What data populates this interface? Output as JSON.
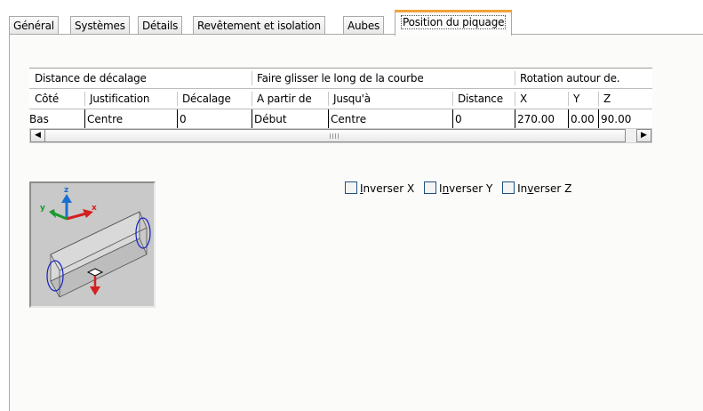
{
  "tabs": [
    {
      "label": "Général",
      "active": false
    },
    {
      "label": "Systèmes",
      "active": false
    },
    {
      "label": "Détails",
      "active": false
    },
    {
      "label": "Revêtement et isolation",
      "active": false
    },
    {
      "label": "Aubes",
      "active": false
    },
    {
      "label": "Position du piquage",
      "active": true
    }
  ],
  "table": {
    "groups": [
      "Distance de décalage",
      "Faire glisser le long de la courbe",
      "Rotation autour de."
    ],
    "columns": [
      "Côté",
      "Justification",
      "Décalage",
      "A partir de",
      "Jusqu'à",
      "Distance",
      "X",
      "Y",
      "Z"
    ],
    "row": [
      "Bas",
      "Centre",
      "0",
      "Début",
      "Centre",
      "0",
      "270.00",
      "0.00",
      "90.00"
    ]
  },
  "scrollbar": {
    "left_arrow": "◀",
    "right_arrow": "▶"
  },
  "preview": {
    "axis_x": "x",
    "axis_y": "y",
    "axis_z": "z"
  },
  "checkboxes": [
    {
      "pre": "",
      "mnemonic": "I",
      "post": "nverser X",
      "checked": false
    },
    {
      "pre": "I",
      "mnemonic": "n",
      "post": "verser Y",
      "checked": false
    },
    {
      "pre": "In",
      "mnemonic": "v",
      "post": "erser Z",
      "checked": false
    }
  ],
  "colors": {
    "active_tab_accent": "#f3a13b",
    "axis_x": "#d42020",
    "axis_y": "#1a9a2e",
    "axis_z": "#1a6fd0",
    "pipe_outline": "#1020c0"
  }
}
